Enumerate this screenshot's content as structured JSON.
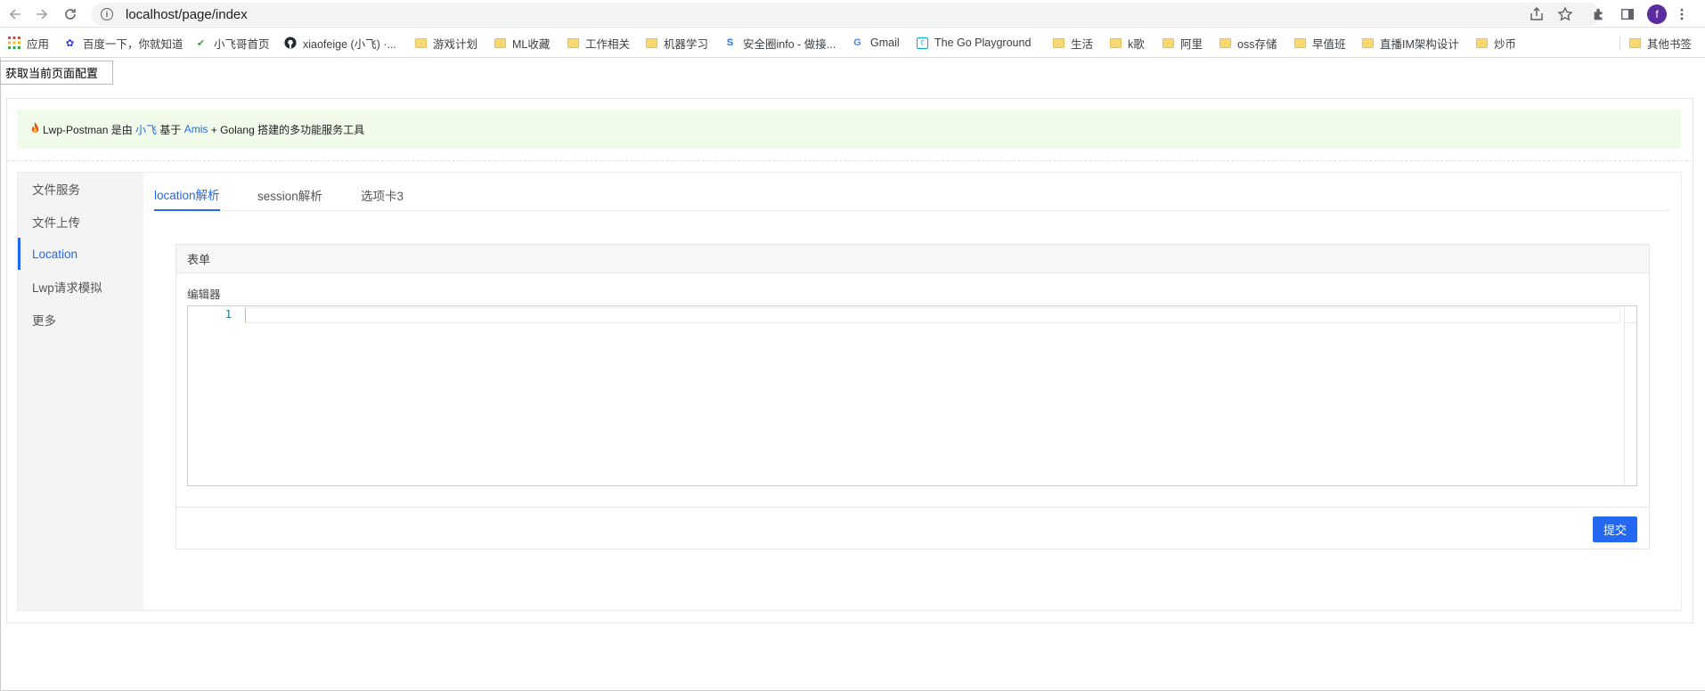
{
  "browser": {
    "url": "localhost/page/index",
    "profile_initial": "f",
    "icons": {
      "back": "arrow-left-icon",
      "forward": "arrow-right-icon",
      "reload": "reload-icon",
      "site_info": "info-icon",
      "share": "share-icon",
      "bookmark": "star-icon",
      "extensions": "puzzle-icon",
      "side_panel": "side-panel-icon",
      "menu": "kebab-menu-icon"
    }
  },
  "bookmarks": [
    {
      "label": "应用",
      "icon": "apps-grid-icon"
    },
    {
      "label": "百度一下，你就知道",
      "icon": "baidu-paw-icon"
    },
    {
      "label": "小飞哥首页",
      "icon": "site-logo-icon"
    },
    {
      "label": "xiaofeige (小飞) ·...",
      "icon": "github-icon"
    },
    {
      "label": "游戏计划",
      "icon": "folder-icon"
    },
    {
      "label": "ML收藏",
      "icon": "folder-icon"
    },
    {
      "label": "工作相关",
      "icon": "folder-icon"
    },
    {
      "label": "机器学习",
      "icon": "folder-icon"
    },
    {
      "label": "安全圈info - 做接...",
      "icon": "s-logo-icon"
    },
    {
      "label": "Gmail",
      "icon": "google-icon"
    },
    {
      "label": "The Go Playground",
      "icon": "go-gopher-icon"
    },
    {
      "label": "生活",
      "icon": "folder-icon"
    },
    {
      "label": "k歌",
      "icon": "folder-icon"
    },
    {
      "label": "阿里",
      "icon": "folder-icon"
    },
    {
      "label": "oss存储",
      "icon": "folder-icon"
    },
    {
      "label": "早值班",
      "icon": "folder-icon"
    },
    {
      "label": "直播IM架构设计",
      "icon": "folder-icon"
    },
    {
      "label": "炒币",
      "icon": "folder-icon"
    },
    {
      "label": "其他书签",
      "icon": "folder-icon"
    }
  ],
  "page": {
    "config_button": "获取当前页面配置",
    "notice": {
      "icon": "flame-icon",
      "part1": "Lwp-Postman 是由 ",
      "link1": "小飞",
      "part2": " 基于 ",
      "link2": "Amis",
      "part3": " + Golang 搭建的多功能服务工具"
    },
    "sidebar": [
      "文件服务",
      "文件上传",
      "Location",
      "Lwp请求模拟",
      "更多"
    ],
    "sidebar_active": "Location",
    "tabs": [
      "location解析",
      "session解析",
      "选项卡3"
    ],
    "tab_active": "location解析",
    "form": {
      "title": "表单",
      "editor_label": "编辑器",
      "line_number": "1",
      "editor_value": "",
      "submit": "提交"
    }
  },
  "colors": {
    "accent": "#2468f2",
    "notice_bg": "#f0fbe9",
    "sidebar_bg": "#f4f4f4"
  }
}
